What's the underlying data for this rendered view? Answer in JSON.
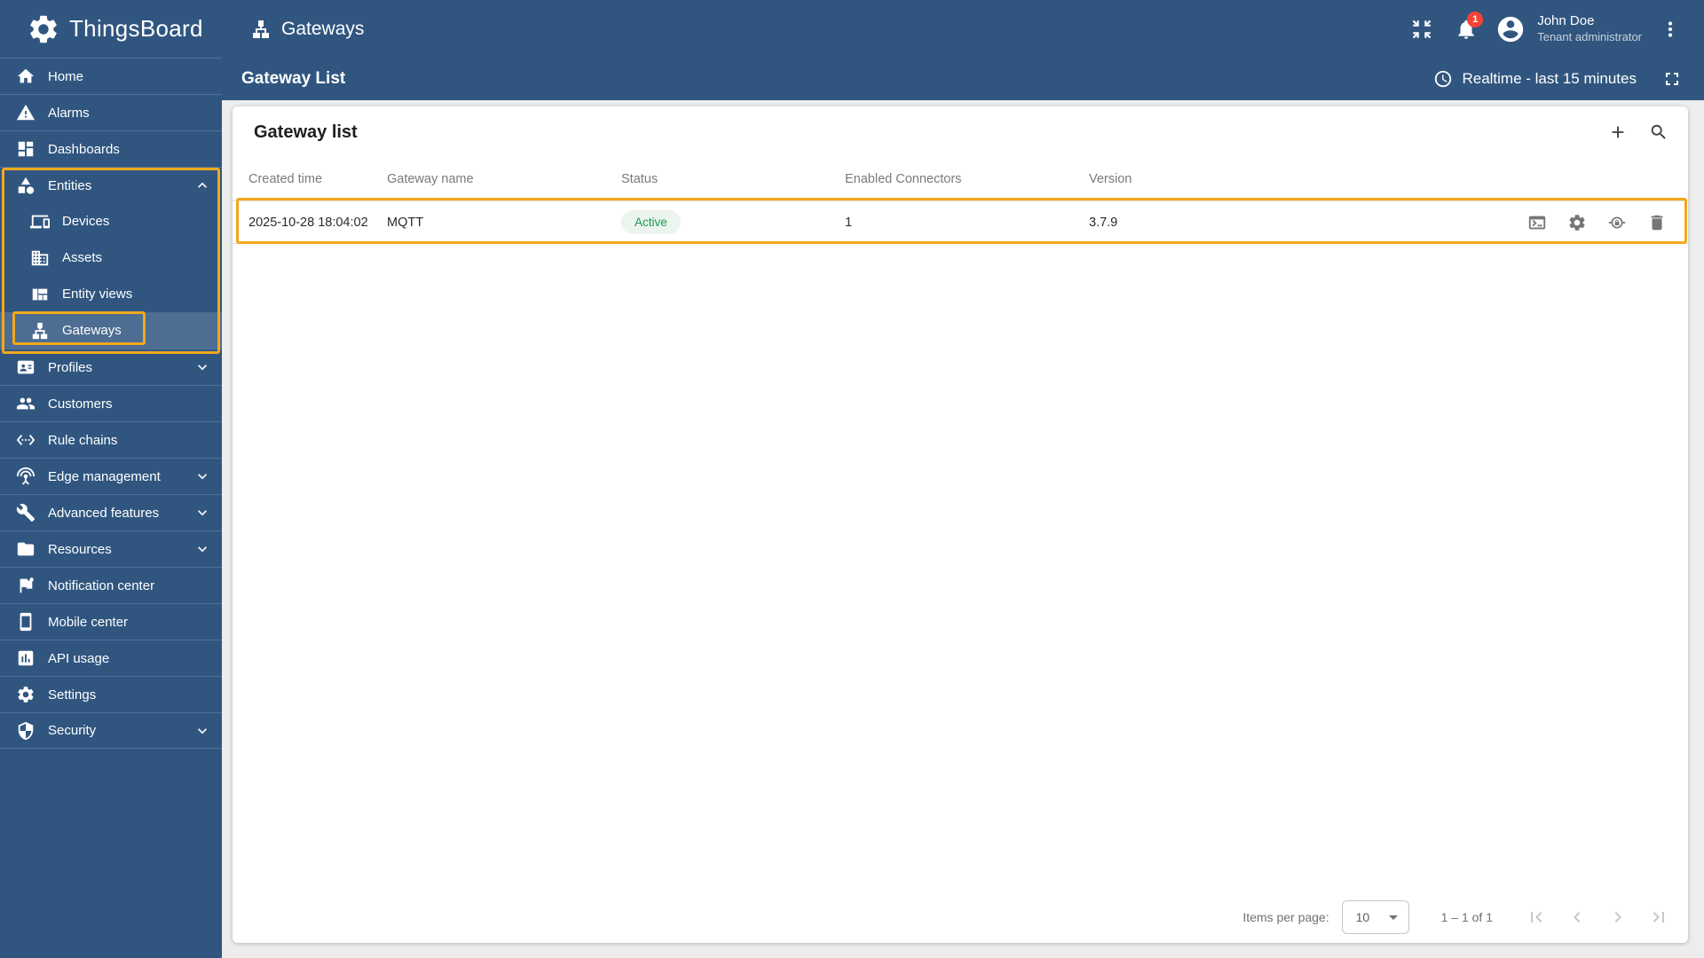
{
  "topbar": {
    "brand": "ThingsBoard",
    "page_title": "Gateways",
    "notifications_badge": "1",
    "user_name": "John Doe",
    "user_role": "Tenant administrator"
  },
  "subheader": {
    "title": "Gateway List",
    "timewindow_label": "Realtime - last 15 minutes"
  },
  "sidebar": {
    "items": [
      {
        "label": "Home",
        "icon": "home"
      },
      {
        "label": "Alarms",
        "icon": "warning-triangle"
      },
      {
        "label": "Dashboards",
        "icon": "dashboard-grid"
      },
      {
        "label": "Entities",
        "icon": "category",
        "expanded": true,
        "highlighted": true
      },
      {
        "label": "Devices",
        "icon": "devices",
        "child": true
      },
      {
        "label": "Assets",
        "icon": "building",
        "child": true
      },
      {
        "label": "Entity views",
        "icon": "view-quilt",
        "child": true
      },
      {
        "label": "Gateways",
        "icon": "lan",
        "child": true,
        "active": true,
        "highlighted": true
      },
      {
        "label": "Profiles",
        "icon": "badge",
        "collapsed": true
      },
      {
        "label": "Customers",
        "icon": "people"
      },
      {
        "label": "Rule chains",
        "icon": "settings-ethernet"
      },
      {
        "label": "Edge management",
        "icon": "antenna",
        "collapsed": true
      },
      {
        "label": "Advanced features",
        "icon": "tools",
        "collapsed": true
      },
      {
        "label": "Resources",
        "icon": "folder",
        "collapsed": true
      },
      {
        "label": "Notification center",
        "icon": "flag"
      },
      {
        "label": "Mobile center",
        "icon": "smartphone"
      },
      {
        "label": "API usage",
        "icon": "bar-chart"
      },
      {
        "label": "Settings",
        "icon": "gear"
      },
      {
        "label": "Security",
        "icon": "shield",
        "collapsed": true
      }
    ]
  },
  "table": {
    "title": "Gateway list",
    "columns": [
      "Created time",
      "Gateway name",
      "Status",
      "Enabled Connectors",
      "Version"
    ],
    "rows": [
      {
        "created_time": "2025-10-28 18:04:02",
        "gateway_name": "MQTT",
        "status": "Active",
        "enabled_connectors": "1",
        "version": "3.7.9"
      }
    ],
    "row_action_icons": [
      "terminal-console-icon",
      "gear-icon",
      "credentials-lock-icon",
      "trash-icon"
    ],
    "toolbar_icons": [
      "plus-icon",
      "search-icon"
    ]
  },
  "paginator": {
    "items_per_page_label": "Items per page:",
    "items_per_page_value": "10",
    "range": "1 – 1 of 1"
  },
  "colors": {
    "primary": "#305680",
    "highlight_box": "#f2a81d",
    "status_active_text": "#1b9850",
    "status_active_bg": "#ecf4ee",
    "notification_badge": "#f44336",
    "content_background": "#ededed"
  }
}
